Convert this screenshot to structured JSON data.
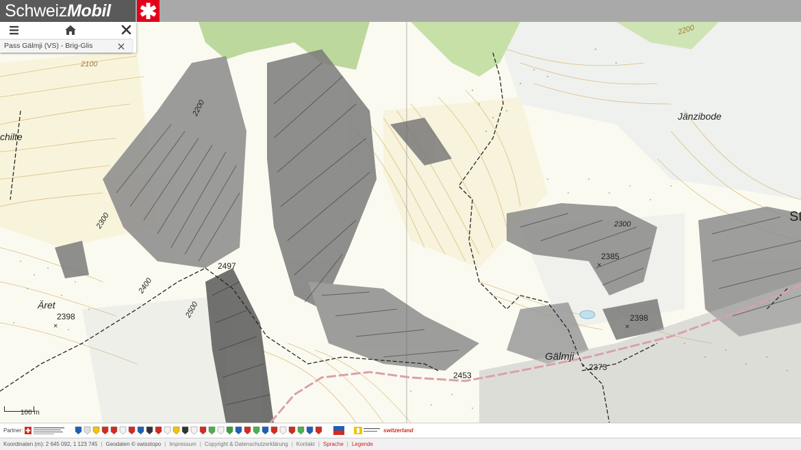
{
  "header": {
    "logo_prefix": "Schweiz",
    "logo_suffix": "Mobil"
  },
  "panel": {
    "route_title": "Pass Gälmji (VS) - Brig-Glis"
  },
  "map": {
    "place_names": [
      {
        "id": "chilte",
        "text": "chilte"
      },
      {
        "id": "jaenzibode",
        "text": "Jänzibode"
      },
      {
        "id": "aeret",
        "text": "Äret"
      },
      {
        "id": "gaelmji",
        "text": "Gälmji"
      },
      {
        "id": "st",
        "text": "St"
      }
    ],
    "spot_heights": [
      {
        "id": "h2497",
        "text": "2497"
      },
      {
        "id": "h2385",
        "text": "2385"
      },
      {
        "id": "h2398a",
        "text": "2398"
      },
      {
        "id": "h2398b",
        "text": "2398"
      },
      {
        "id": "h2453",
        "text": "2453"
      },
      {
        "id": "h2373",
        "text": "2373"
      }
    ],
    "contour_labels": [
      {
        "id": "c2100",
        "text": "2100"
      },
      {
        "id": "c2200a",
        "text": "2200"
      },
      {
        "id": "c2200b",
        "text": "2200"
      },
      {
        "id": "c2300a",
        "text": "2300"
      },
      {
        "id": "c2300b",
        "text": "2300"
      },
      {
        "id": "c2400",
        "text": "2400"
      },
      {
        "id": "c2500",
        "text": "2500"
      }
    ],
    "scale_label": "100 m",
    "colors": {
      "background": "#fbfaf0",
      "contour": "#d9b878",
      "rock": "#4a4a4a",
      "forest": "#b8d89a",
      "route": "#d9a0ae",
      "trail": "#222222"
    }
  },
  "partners": {
    "label": "Partner:",
    "switzerland": "switzerland"
  },
  "footer": {
    "coordinates": "Koordinaten (m): 2 645 092, 1 123 745",
    "geodata": "Geodaten © swisstopo",
    "imprint": "Impressum",
    "copyright": "Copyright & Datenschutzerklärung",
    "contact": "Kontakt",
    "language": "Sprache",
    "legend": "Legende"
  }
}
